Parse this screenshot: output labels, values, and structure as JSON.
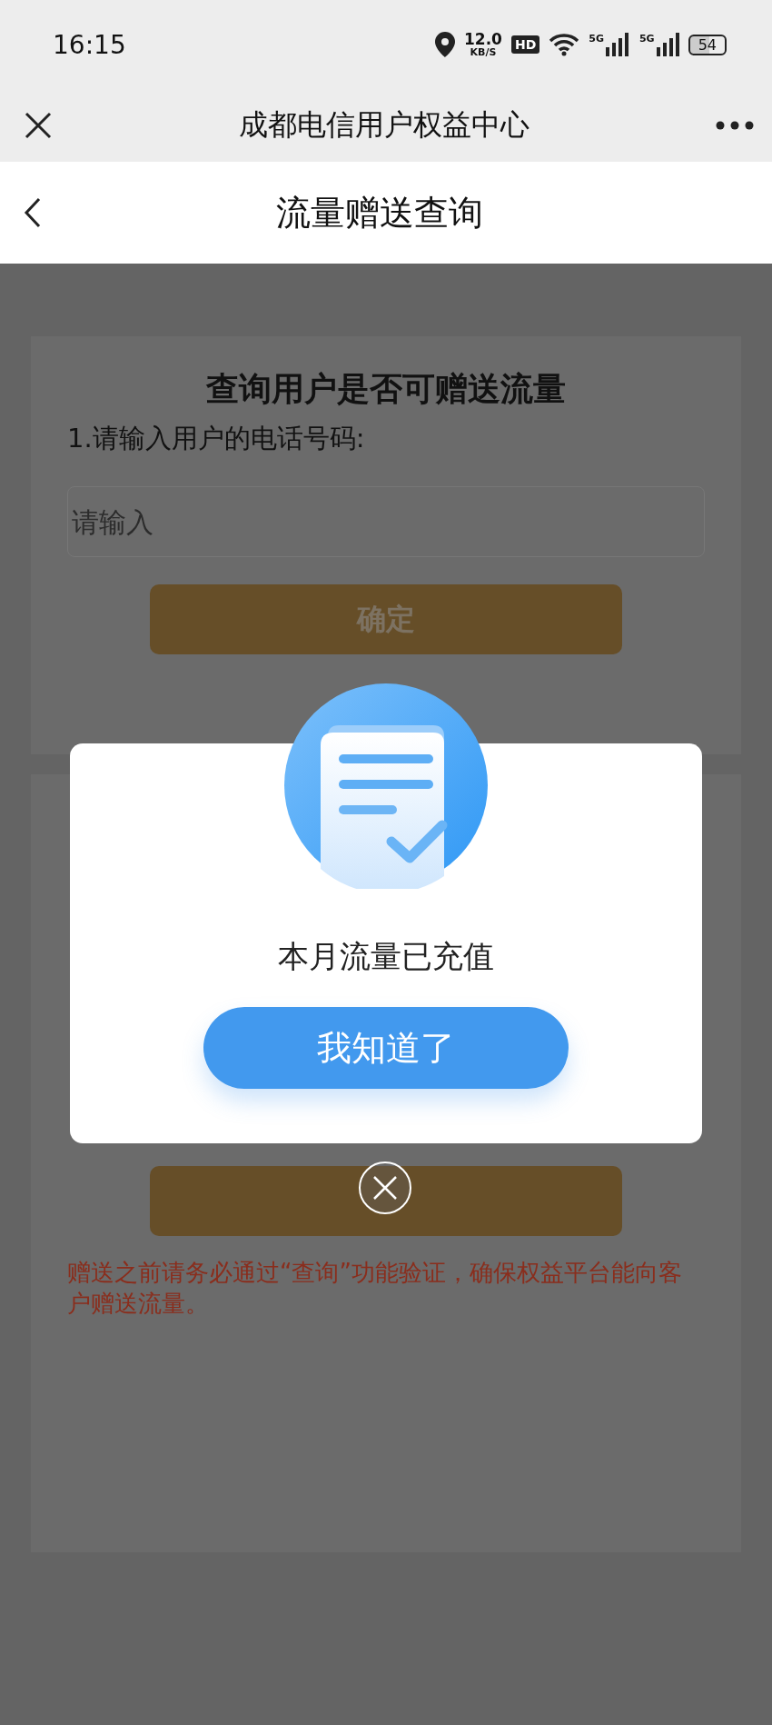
{
  "status_bar": {
    "time": "16:15",
    "speed_value": "12.0",
    "speed_unit": "KB/S",
    "hd_badge": "HD",
    "signals": [
      {
        "label": "5G"
      },
      {
        "label": "5G"
      }
    ],
    "battery": "54"
  },
  "app_bar": {
    "title": "成都电信用户权益中心"
  },
  "nav_bar": {
    "title": "流量赠送查询"
  },
  "query_card": {
    "title": "查询用户是否可赠送流量",
    "label": "1.请输入用户的电话号码:",
    "input": {
      "placeholder": "请输入"
    },
    "button": "确定"
  },
  "gift_card": {
    "notice": "赠送之前请务必通过“查询”功能验证，确保权益平台能向客户赠送流量。"
  },
  "dialog": {
    "message": "本月流量已充值",
    "button": "我知道了"
  }
}
